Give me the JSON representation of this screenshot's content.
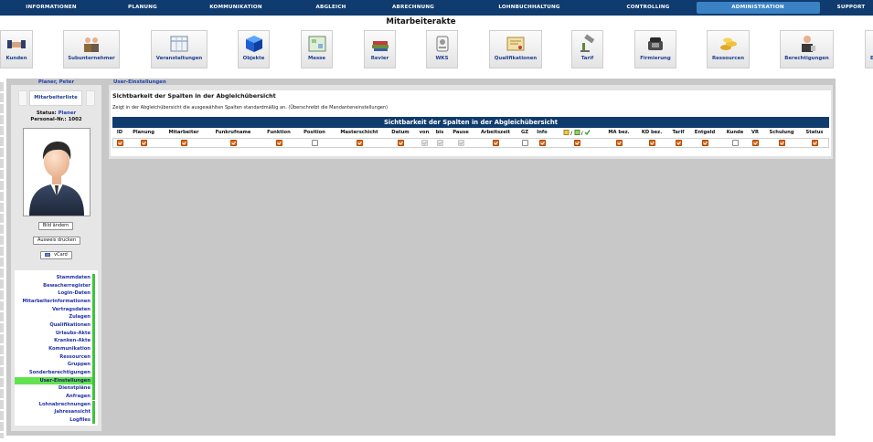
{
  "nav": {
    "items": [
      "INFORMATIONEN",
      "PLANUNG",
      "KOMMUNIKATION",
      "ABGLEICH",
      "ABRECHNUNG",
      "LOHNBUCHHALTUNG",
      "CONTROLLING",
      "ADMINISTRATION",
      "SUPPORT"
    ],
    "active": "ADMINISTRATION"
  },
  "page_title": "Mitarbeiterakte",
  "toolbar": {
    "items": [
      {
        "label": "Kunden",
        "icon": "handshake-icon"
      },
      {
        "label": "Subunternehmer",
        "icon": "group-icon"
      },
      {
        "label": "Veranstaltungen",
        "icon": "schedule-icon"
      },
      {
        "label": "Objekte",
        "icon": "cube-icon"
      },
      {
        "label": "Messe",
        "icon": "floorplan-icon"
      },
      {
        "label": "Revier",
        "icon": "books-icon"
      },
      {
        "label": "WKS",
        "icon": "badge-icon"
      },
      {
        "label": "Qualifikationen",
        "icon": "certificate-icon"
      },
      {
        "label": "Tarif",
        "icon": "gavel-icon"
      },
      {
        "label": "Firmierung",
        "icon": "phone-icon"
      },
      {
        "label": "Ressourcen",
        "icon": "coins-icon"
      },
      {
        "label": "Berechtigungen",
        "icon": "users-icon"
      }
    ],
    "cut_off_letter": "E"
  },
  "employee": {
    "name": "Planer, Peter",
    "list_button": "Mitarbeiterliste",
    "status_label": "Status:",
    "status_value": "Planer",
    "personnel_label": "Personal-Nr.:",
    "personnel_value": "1002",
    "change_picture": "Bild ändern",
    "print_id": "Ausweis drucken",
    "vcard": "vCard"
  },
  "side_links": [
    "Stammdaten",
    "Bewacherregister",
    "Login-Daten",
    "Mitarbeiterinformationen",
    "Vertragsdaten",
    "Zulagen",
    "Qualifikationen",
    "Urlaubs-Akte",
    "Kranken-Akte",
    "Kommunikation",
    "Ressourcen",
    "Gruppen",
    "Sonderberechtigungen",
    "User-Einstellungen",
    "Dienstpläne",
    "Anfragen",
    "Lohnabrechnungen",
    "Jahresansicht",
    "Logfiles"
  ],
  "active_link": "User-Einstellungen",
  "content": {
    "tab_title": "User-Einstellungen",
    "section_title": "Sichtbarkeit der Spalten in der Abgleichübersicht",
    "section_desc": "Zeigt in der Abgleichübersicht die ausgewählten Spalten standardmäßig an. (Überschreibt die Mandanteneinstellungen)",
    "table_title": "Sichtbarkeit der Spalten in der Abgleichübersicht",
    "columns": [
      {
        "label": "ID",
        "checked": true
      },
      {
        "label": "Planung",
        "checked": true
      },
      {
        "label": "Mitarbeiter",
        "checked": true
      },
      {
        "label": "Funkrufname",
        "checked": true
      },
      {
        "label": "Funktion",
        "checked": true
      },
      {
        "label": "Position",
        "checked": false
      },
      {
        "label": "Masterschicht",
        "checked": true
      },
      {
        "label": "Datum",
        "checked": true
      },
      {
        "label": "von",
        "checked": true,
        "disabled": true
      },
      {
        "label": "bis",
        "checked": true,
        "disabled": true
      },
      {
        "label": "Pause",
        "checked": true,
        "disabled": true
      },
      {
        "label": "Arbeitszeit",
        "checked": true
      },
      {
        "label": "GZ",
        "checked": false
      },
      {
        "label": "Info",
        "checked": true
      },
      {
        "label": "/ /",
        "checked": true,
        "icons": [
          "note-icon",
          "edit-icon",
          "check-icon"
        ]
      },
      {
        "label": "MA bez.",
        "checked": true
      },
      {
        "label": "KD bez.",
        "checked": true
      },
      {
        "label": "Tarif",
        "checked": true
      },
      {
        "label": "Entgeld",
        "checked": true
      },
      {
        "label": "Kunde",
        "checked": false
      },
      {
        "label": "VR",
        "checked": true
      },
      {
        "label": "Schulung",
        "checked": true
      },
      {
        "label": "Status",
        "checked": true
      }
    ]
  },
  "colors": {
    "nav_bg": "#0f3b6e",
    "nav_active": "#3a82c4",
    "link_text": "#2233aa",
    "active_link_bg": "#62e24f",
    "checkbox_on": "#e06b1a"
  }
}
